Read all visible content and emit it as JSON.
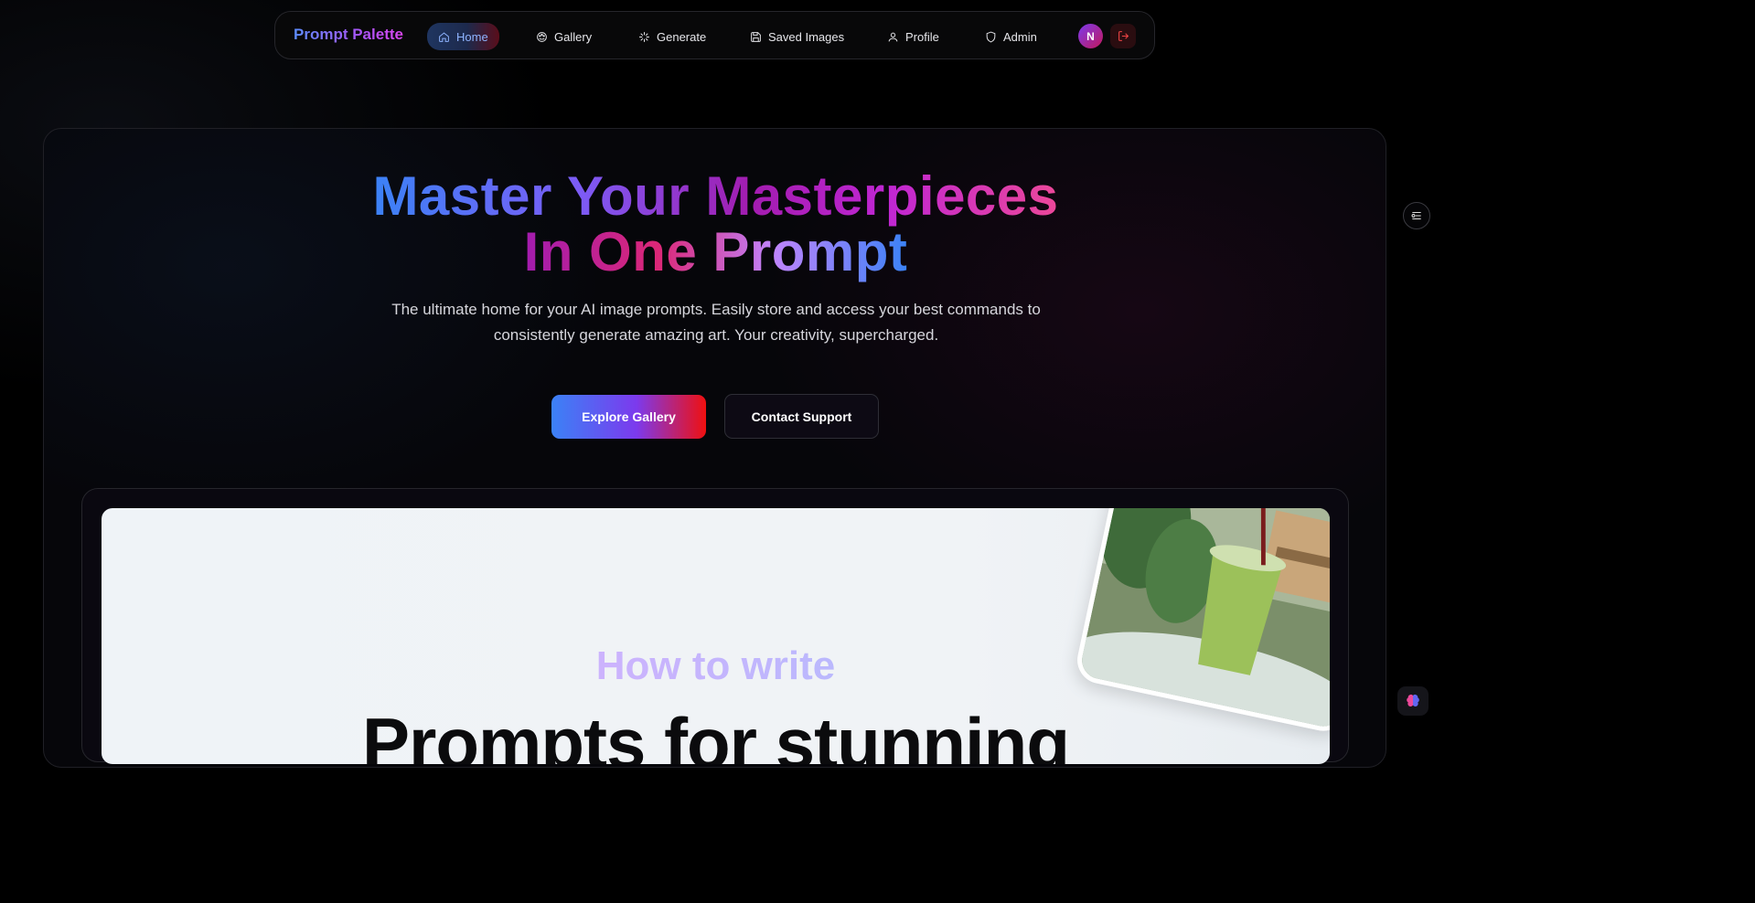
{
  "nav": {
    "brand": "Prompt Palette",
    "items": [
      {
        "label": "Home",
        "icon": "home-icon",
        "active": true
      },
      {
        "label": "Gallery",
        "icon": "palette-icon",
        "active": false
      },
      {
        "label": "Generate",
        "icon": "sparkle-icon",
        "active": false
      },
      {
        "label": "Saved Images",
        "icon": "save-icon",
        "active": false
      },
      {
        "label": "Profile",
        "icon": "user-icon",
        "active": false
      },
      {
        "label": "Admin",
        "icon": "shield-icon",
        "active": false
      }
    ],
    "avatar_initial": "N",
    "logout_icon": "logout-icon"
  },
  "hero": {
    "headline_line1": "Master Your Masterpieces",
    "headline_line2": "In One Prompt",
    "subtitle": "The ultimate home for your AI image prompts. Easily store and access your best commands to consistently generate amazing art. Your creativity, supercharged.",
    "primary_button": "Explore Gallery",
    "secondary_button": "Contact Support"
  },
  "banner": {
    "kicker": "How to write",
    "title": "Prompts for stunning"
  },
  "colors": {
    "accent_blue": "#3b82f6",
    "accent_purple": "#a855f7",
    "accent_pink": "#ec4899",
    "accent_red": "#ef1010"
  }
}
